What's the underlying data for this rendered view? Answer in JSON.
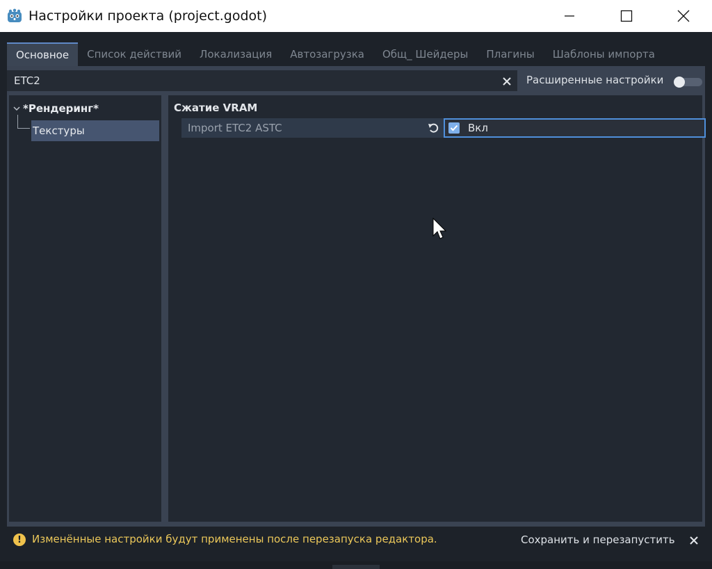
{
  "window": {
    "title": "Настройки проекта (project.godot)",
    "app_icon": "godot-icon",
    "controls": [
      "minimize-icon",
      "maximize-icon",
      "close-icon"
    ]
  },
  "tabs": [
    {
      "label": "Основное",
      "active": true
    },
    {
      "label": "Список действий",
      "active": false
    },
    {
      "label": "Локализация",
      "active": false
    },
    {
      "label": "Автозагрузка",
      "active": false
    },
    {
      "label": "Общ_ Шейдеры",
      "active": false
    },
    {
      "label": "Плагины",
      "active": false
    },
    {
      "label": "Шаблоны импорта",
      "active": false
    }
  ],
  "search": {
    "value": "ETC2",
    "clear_icon": "clear-icon"
  },
  "advanced_settings": {
    "label": "Расширенные настройки",
    "enabled": false
  },
  "tree": {
    "root": "*Рендеринг*",
    "child": "Текстуры"
  },
  "settings": {
    "section": "Сжатие VRAM",
    "property": {
      "name": "Import ETC2 ASTC",
      "value_label": "Вкл",
      "checked": true,
      "revert_icon": "revert-icon"
    }
  },
  "footer": {
    "warning": "Изменённые настройки будут применены после перезапуска редактора.",
    "save_restart": "Сохранить и перезапустить",
    "close_icon": "close-icon"
  },
  "colors": {
    "accent": "#4f8fdb",
    "warning": "#ecc85a",
    "background": "#1d2229"
  }
}
